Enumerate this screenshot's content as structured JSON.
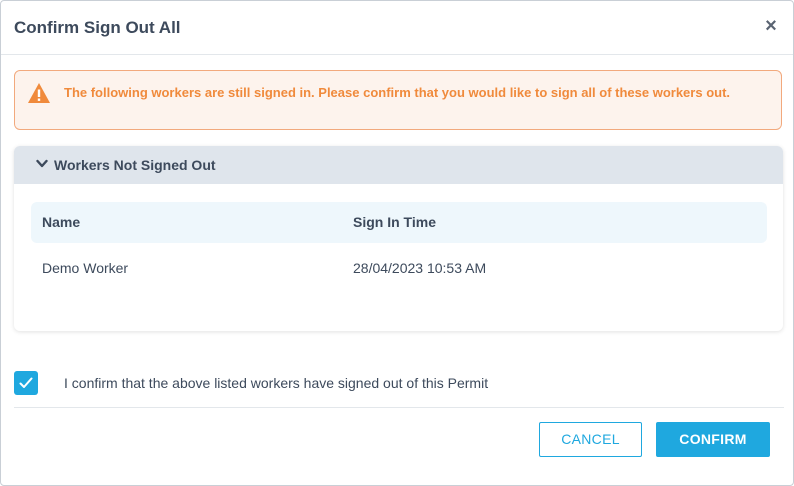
{
  "dialog": {
    "title": "Confirm Sign Out All",
    "close_label": "×"
  },
  "alert": {
    "icon": "warning-triangle-icon",
    "message": "The following workers are still signed in. Please confirm that you would like to sign all of these workers out.",
    "color": "#f08a3c"
  },
  "panel": {
    "title": "Workers Not Signed Out",
    "columns": [
      "Name",
      "Sign In Time"
    ],
    "rows": [
      {
        "name": "Demo Worker",
        "sign_in_time": "28/04/2023 10:53 AM"
      }
    ]
  },
  "confirmation": {
    "checked": true,
    "label": "I confirm that the above listed workers have signed out of this Permit"
  },
  "buttons": {
    "cancel": "CANCEL",
    "confirm": "CONFIRM"
  },
  "colors": {
    "accent": "#1fa8df",
    "warning": "#f08a3c"
  }
}
